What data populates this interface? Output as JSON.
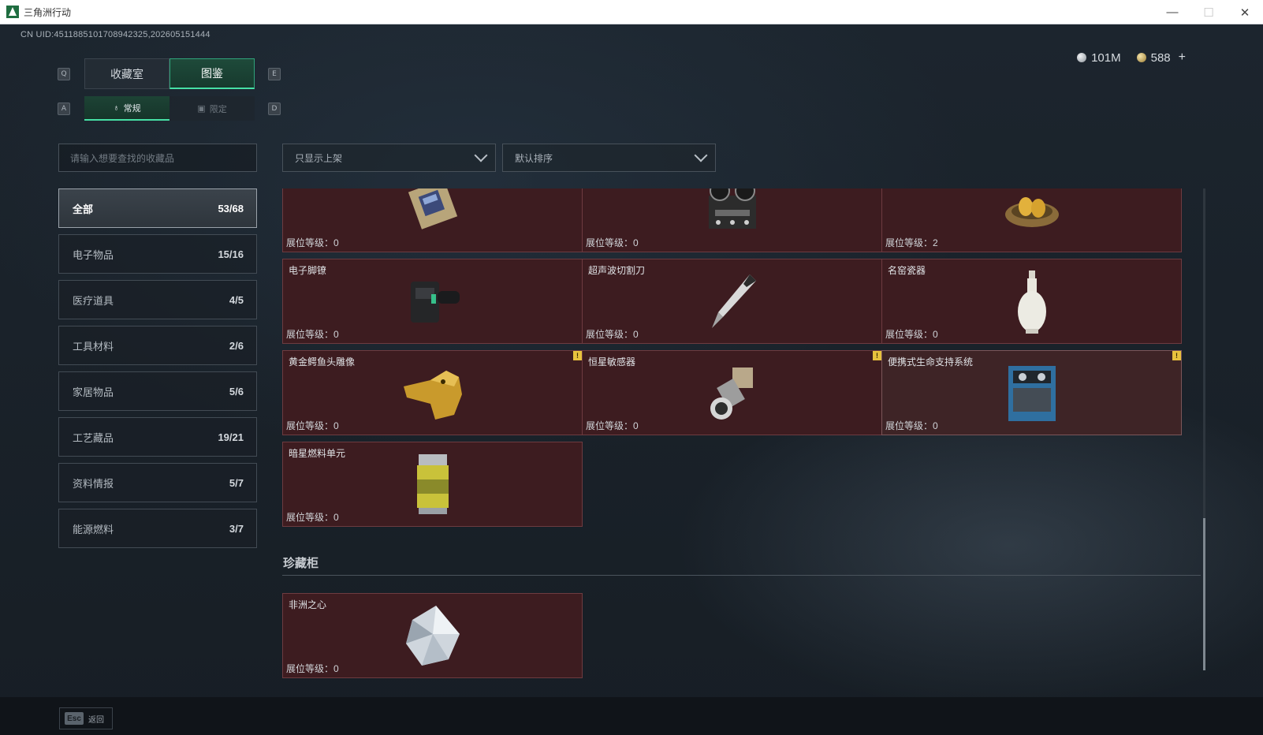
{
  "window": {
    "title": "三角洲行动",
    "minimize": "—",
    "maximize": "☐",
    "close": "✕"
  },
  "uid_text": "CN UID:4511885101708942325,202605151444",
  "currency": {
    "silver": "101M",
    "gold": "588",
    "add": "+"
  },
  "keys": {
    "prev_main": "Q",
    "next_main": "E",
    "prev_sub": "A",
    "next_sub": "D"
  },
  "main_tabs": [
    {
      "label": "收藏室",
      "active": false
    },
    {
      "label": "图鉴",
      "active": true
    }
  ],
  "sub_tabs": [
    {
      "label": "常规",
      "icon": "bottle-icon",
      "active": true
    },
    {
      "label": "限定",
      "icon": "image-icon",
      "active": false
    }
  ],
  "search": {
    "placeholder": "请输入想要查找的收藏品"
  },
  "filters": {
    "shelf_filter": "只显示上架",
    "sort": "默认排序"
  },
  "categories": [
    {
      "label": "全部",
      "count": "53/68",
      "active": true
    },
    {
      "label": "电子物品",
      "count": "15/16"
    },
    {
      "label": "医疗道具",
      "count": "4/5"
    },
    {
      "label": "工具材料",
      "count": "2/6"
    },
    {
      "label": "家居物品",
      "count": "5/6"
    },
    {
      "label": "工艺藏品",
      "count": "19/21"
    },
    {
      "label": "资料情报",
      "count": "5/7"
    },
    {
      "label": "能源燃料",
      "count": "3/7"
    }
  ],
  "items": [
    {
      "name": "",
      "level": "展位等级：0"
    },
    {
      "name": "",
      "level": "展位等级：0"
    },
    {
      "name": "",
      "level": "展位等级：2"
    },
    {
      "name": "电子脚镣",
      "level": "展位等级：0"
    },
    {
      "name": "超声波切割刀",
      "level": "展位等级：0"
    },
    {
      "name": "名窑瓷器",
      "level": "展位等级：0"
    },
    {
      "name": "黄金鳄鱼头雕像",
      "level": "展位等级：0",
      "warning": "!"
    },
    {
      "name": "恒星敏感器",
      "level": "展位等级：0",
      "warning": "!"
    },
    {
      "name": "便携式生命支持系统",
      "level": "展位等级：0",
      "warning": "!"
    },
    {
      "name": "暗星燃料单元",
      "level": "展位等级：0"
    }
  ],
  "treasure_section": {
    "title": "珍藏柜",
    "items": [
      {
        "name": "非洲之心",
        "level": "展位等级：0"
      }
    ]
  },
  "bottom": {
    "esc_key": "Esc",
    "back_label": "返回"
  },
  "colors": {
    "accent_green": "#46e0a5",
    "card_bg": "#3d1c20",
    "warning": "#e8c23d"
  }
}
